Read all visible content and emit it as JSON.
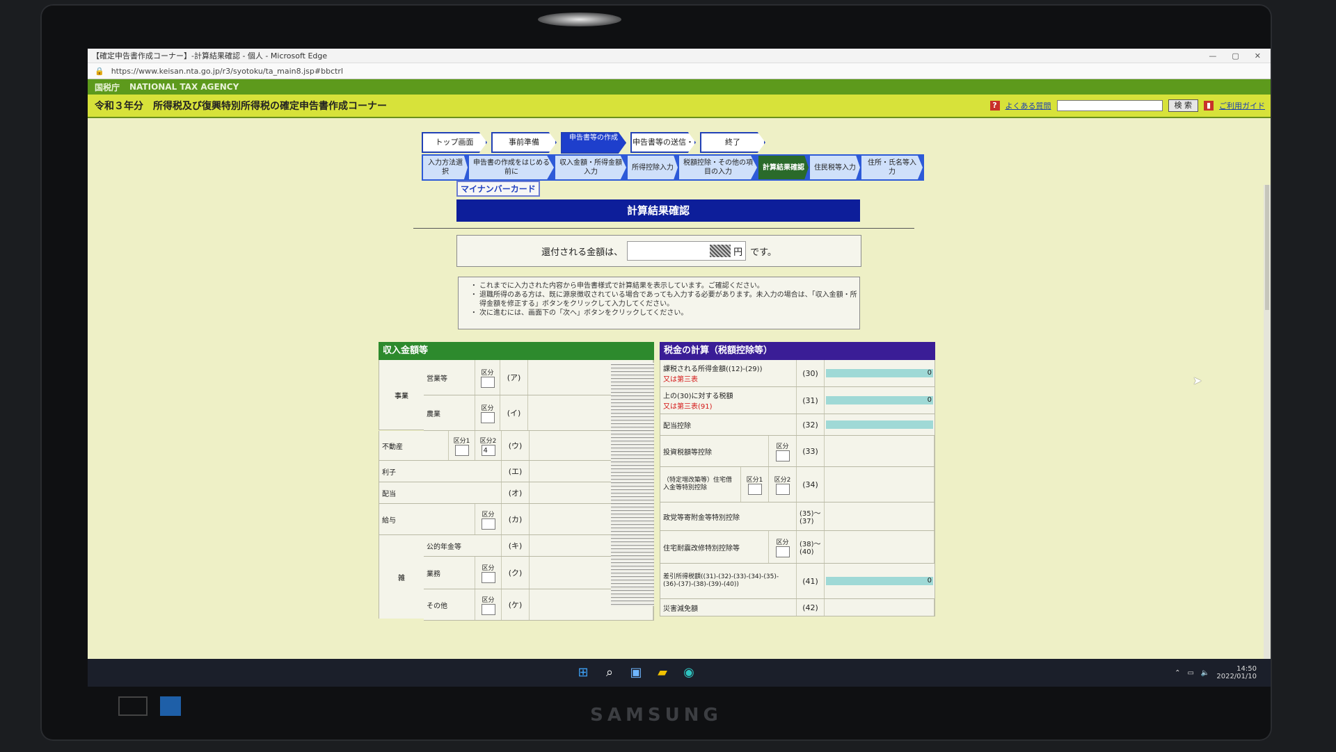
{
  "window": {
    "title": "【確定申告書作成コーナー】-計算結果確認 - 個人 - Microsoft Edge",
    "url": "https://www.keisan.nta.go.jp/r3/syotoku/ta_main8.jsp#bbctrl",
    "controls": [
      "—",
      "▢",
      "✕"
    ]
  },
  "agency": {
    "short": "国税庁",
    "name": "NATIONAL TAX AGENCY"
  },
  "header": {
    "title": "令和３年分　所得税及び復興特別所得税の確定申告書作成コーナー",
    "faq_label": "よくある質問",
    "search_label": "検 索",
    "guide_label": "ご利用ガイド"
  },
  "steps_main": [
    {
      "label": "トップ画面",
      "active": false
    },
    {
      "label": "事前準備",
      "active": false
    },
    {
      "label": "申告書等の作成",
      "active": true
    },
    {
      "label": "申告書等の送信・印刷",
      "active": false
    },
    {
      "label": "終了",
      "active": false
    }
  ],
  "steps_sub": [
    {
      "label": "入力方法選択",
      "active": false
    },
    {
      "label": "申告書の作成をはじめる前に",
      "active": false
    },
    {
      "label": "収入金額・所得金額入力",
      "active": false
    },
    {
      "label": "所得控除入力",
      "active": false
    },
    {
      "label": "税額控除・その他の項目の入力",
      "active": false
    },
    {
      "label": "計算結果確認",
      "active": true
    },
    {
      "label": "住民税等入力",
      "active": false
    },
    {
      "label": "住所・氏名等入力",
      "active": false
    }
  ],
  "mynumber_label": "マイナンバーカード",
  "page_title": "計算結果確認",
  "refund": {
    "prefix": "還付される金額は、",
    "unit": "円",
    "suffix": "です。"
  },
  "notes": [
    "これまでに入力された内容から申告書様式で計算結果を表示しています。ご確認ください。",
    "退職所得のある方は、既に源泉徴収されている場合であっても入力する必要があります。未入力の場合は、「収入金額・所得金額を修正する」ボタンをクリックして入力してください。",
    "次に進むには、画面下の「次へ」ボタンをクリックしてください。"
  ],
  "income_panel": {
    "title": "収入金額等",
    "kubun_label": "区分",
    "kubun1_label": "区分1",
    "kubun2_label": "区分2",
    "jigyo_label": "事業",
    "zatsu_label": "雑",
    "rows": [
      {
        "group": "事業",
        "label": "営業等",
        "code": "(ア)"
      },
      {
        "group": "事業",
        "label": "農業",
        "code": "(イ)"
      },
      {
        "label": "不動産",
        "code": "(ウ)",
        "kubun2_value": "4"
      },
      {
        "label": "利子",
        "code": "(エ)"
      },
      {
        "label": "配当",
        "code": "(オ)"
      },
      {
        "label": "給与",
        "code": "(カ)"
      },
      {
        "group": "雑",
        "label": "公的年金等",
        "code": "(キ)"
      },
      {
        "group": "雑",
        "label": "業務",
        "code": "(ク)"
      },
      {
        "group": "雑",
        "label": "その他",
        "code": "(ケ)"
      }
    ]
  },
  "tax_panel": {
    "title": "税金の計算（税額控除等）",
    "rows": [
      {
        "label": "課税される所得金額((12)-(29))",
        "label_red": "又は第三表",
        "code": "(30)",
        "value": "0",
        "bar": true
      },
      {
        "label": "上の(30)に対する税額",
        "label_red": "又は第三表(91)",
        "code": "(31)",
        "value": "0",
        "bar": true
      },
      {
        "label": "配当控除",
        "code": "(32)",
        "value": "",
        "bar": true
      },
      {
        "label": "投資税額等控除",
        "code": "(33)",
        "kubun": true
      },
      {
        "label": "（特定増改築等）住宅借入金等特別控除",
        "code": "(34)",
        "kubun12": true
      },
      {
        "label": "政党等寄附金等特別控除",
        "code": "(35)～(37)"
      },
      {
        "label": "住宅耐震改修特別控除等",
        "code": "(38)～(40)",
        "kubun": true
      },
      {
        "label": "差引所得税額((31)-(32)-(33)-(34)-(35)-(36)-(37)-(38)-(39)-(40))",
        "code": "(41)",
        "value": "0",
        "bar": true
      },
      {
        "label": "災害減免額",
        "code": "(42)"
      }
    ]
  },
  "taskbar": {
    "time": "14:50",
    "date": "2022/01/10"
  },
  "monitor_brand": "SAMSUNG",
  "colors": {
    "nta_green": "#5d9a1c",
    "header_yellow": "#d7e23a",
    "step_blue": "#1e3fcc",
    "title_navy": "#0d1e9a",
    "tax_purple": "#3a1d96",
    "income_green": "#2d8a2d"
  }
}
